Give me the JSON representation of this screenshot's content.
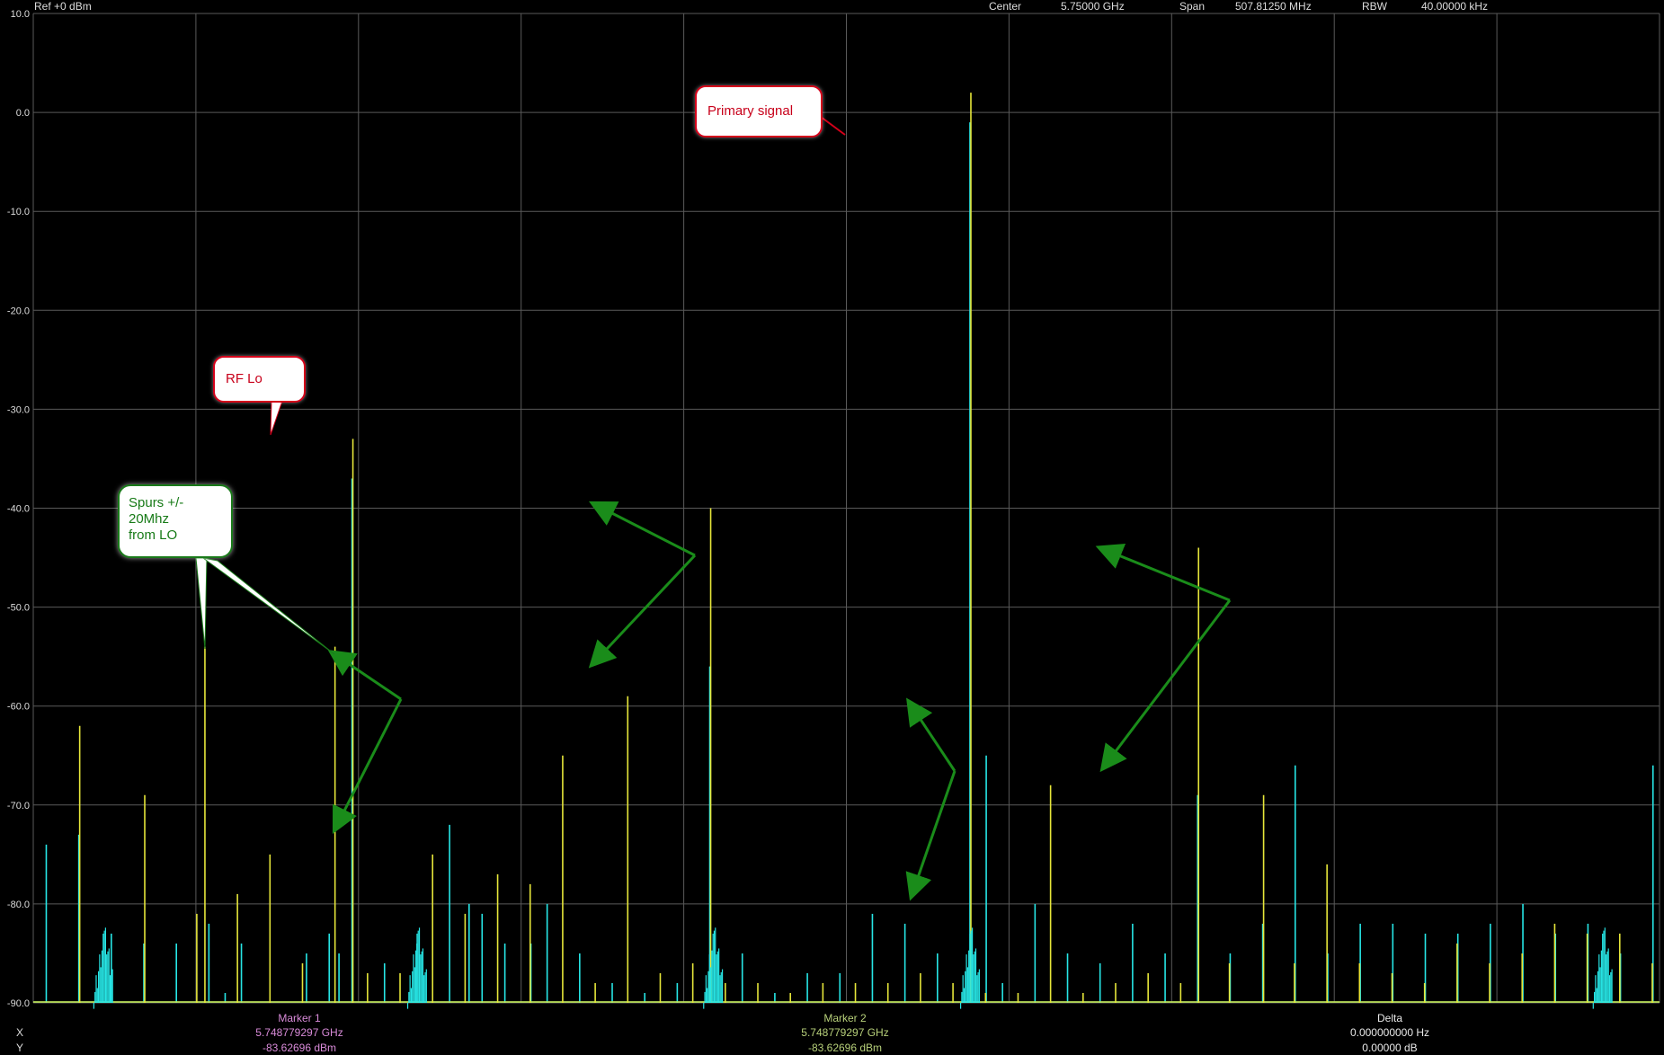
{
  "header": {
    "ref_level": "Ref +0 dBm",
    "center_label": "Center",
    "center_value": "5.75000 GHz",
    "span_label": "Span",
    "span_value": "507.81250 MHz",
    "rbw_label": "RBW",
    "rbw_value": "40.00000 kHz"
  },
  "markers": {
    "x_label": "X",
    "y_label": "Y",
    "marker1": {
      "name": "Marker 1",
      "x": "5.748779297 GHz",
      "y": "-83.62696 dBm",
      "color": "#d98bd9"
    },
    "marker2": {
      "name": "Marker 2",
      "x": "5.748779297 GHz",
      "y": "-83.62696 dBm",
      "color": "#b7d07a"
    },
    "delta": {
      "name": "Delta",
      "x": "0.000000000 Hz",
      "y": "0.00000 dB",
      "color": "#e8e8e8"
    }
  },
  "annotations": {
    "primary": "Primary signal",
    "rf_lo": "RF Lo",
    "spurs": [
      "Spurs +/-",
      "20Mhz",
      "from LO"
    ]
  },
  "colors": {
    "background": "#000000",
    "grid": "#5a5a5a",
    "trace_cyan": "#27e6e6",
    "trace_yellow": "#e6e63a",
    "arrow_green": "#1a8c1a",
    "callout_red": "#d4001a"
  },
  "chart_data": {
    "type": "line",
    "title": "",
    "xlabel": "",
    "ylabel": "",
    "ylim": [
      -90,
      10
    ],
    "y_ticks": [
      "10.0",
      "0.0",
      "-10.0",
      "-20.0",
      "-30.0",
      "-40.0",
      "-50.0",
      "-60.0",
      "-70.0",
      "-80.0",
      "-90.0"
    ],
    "x_divisions": 10,
    "x_unit": "frequency (span 507.81250 MHz, center 5.75000 GHz)",
    "series": [
      {
        "color": "#27e6e6",
        "spikes": [
          [
            0.008,
            -74
          ],
          [
            0.028,
            -73
          ],
          [
            0.048,
            -83
          ],
          [
            0.068,
            -84
          ],
          [
            0.088,
            -84
          ],
          [
            0.108,
            -82
          ],
          [
            0.118,
            -89
          ],
          [
            0.128,
            -84
          ],
          [
            0.148,
            -90
          ],
          [
            0.168,
            -85
          ],
          [
            0.182,
            -83
          ],
          [
            0.188,
            -85
          ],
          [
            0.196,
            -37
          ],
          [
            0.216,
            -86
          ],
          [
            0.236,
            -84
          ],
          [
            0.256,
            -72
          ],
          [
            0.268,
            -80
          ],
          [
            0.276,
            -81
          ],
          [
            0.29,
            -84
          ],
          [
            0.306,
            -84
          ],
          [
            0.316,
            -80
          ],
          [
            0.336,
            -85
          ],
          [
            0.356,
            -88
          ],
          [
            0.376,
            -89
          ],
          [
            0.396,
            -88
          ],
          [
            0.416,
            -56
          ],
          [
            0.436,
            -85
          ],
          [
            0.456,
            -89
          ],
          [
            0.476,
            -87
          ],
          [
            0.496,
            -87
          ],
          [
            0.516,
            -81
          ],
          [
            0.536,
            -82
          ],
          [
            0.556,
            -85
          ],
          [
            0.576,
            -1
          ],
          [
            0.586,
            -65
          ],
          [
            0.596,
            -88
          ],
          [
            0.616,
            -80
          ],
          [
            0.636,
            -85
          ],
          [
            0.656,
            -86
          ],
          [
            0.676,
            -82
          ],
          [
            0.696,
            -85
          ],
          [
            0.716,
            -69
          ],
          [
            0.736,
            -85
          ],
          [
            0.756,
            -82
          ],
          [
            0.776,
            -66
          ],
          [
            0.796,
            -85
          ],
          [
            0.816,
            -82
          ],
          [
            0.836,
            -82
          ],
          [
            0.856,
            -83
          ],
          [
            0.876,
            -83
          ],
          [
            0.896,
            -82
          ],
          [
            0.916,
            -80
          ],
          [
            0.936,
            -83
          ],
          [
            0.956,
            -82
          ],
          [
            0.976,
            -85
          ],
          [
            0.996,
            -66
          ]
        ]
      },
      {
        "color": "#e6e63a",
        "spikes": [
          [
            0.028,
            -62
          ],
          [
            0.068,
            -69
          ],
          [
            0.1,
            -81
          ],
          [
            0.105,
            -54
          ],
          [
            0.125,
            -79
          ],
          [
            0.145,
            -75
          ],
          [
            0.165,
            -86
          ],
          [
            0.185,
            -54
          ],
          [
            0.196,
            -33
          ],
          [
            0.205,
            -87
          ],
          [
            0.225,
            -87
          ],
          [
            0.245,
            -75
          ],
          [
            0.265,
            -81
          ],
          [
            0.285,
            -77
          ],
          [
            0.305,
            -78
          ],
          [
            0.325,
            -65
          ],
          [
            0.345,
            -88
          ],
          [
            0.365,
            -59
          ],
          [
            0.385,
            -87
          ],
          [
            0.405,
            -86
          ],
          [
            0.416,
            -40
          ],
          [
            0.425,
            -88
          ],
          [
            0.445,
            -88
          ],
          [
            0.465,
            -89
          ],
          [
            0.485,
            -88
          ],
          [
            0.505,
            -88
          ],
          [
            0.525,
            -88
          ],
          [
            0.545,
            -87
          ],
          [
            0.565,
            -88
          ],
          [
            0.576,
            2
          ],
          [
            0.585,
            -89
          ],
          [
            0.605,
            -89
          ],
          [
            0.625,
            -68
          ],
          [
            0.645,
            -89
          ],
          [
            0.665,
            -88
          ],
          [
            0.685,
            -87
          ],
          [
            0.705,
            -88
          ],
          [
            0.716,
            -44
          ],
          [
            0.735,
            -86
          ],
          [
            0.756,
            -69
          ],
          [
            0.775,
            -86
          ],
          [
            0.795,
            -76
          ],
          [
            0.815,
            -86
          ],
          [
            0.835,
            -87
          ],
          [
            0.855,
            -88
          ],
          [
            0.875,
            -84
          ],
          [
            0.895,
            -86
          ],
          [
            0.915,
            -85
          ],
          [
            0.935,
            -82
          ],
          [
            0.955,
            -83
          ],
          [
            0.975,
            -83
          ],
          [
            0.995,
            -86
          ]
        ]
      }
    ]
  }
}
